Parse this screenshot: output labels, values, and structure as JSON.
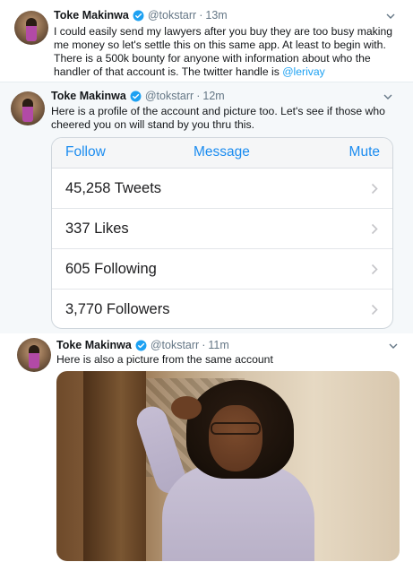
{
  "colors": {
    "link": "#1da1f2",
    "verified": "#1da1f2",
    "card_action": "#1b8cf0"
  },
  "tweets": [
    {
      "name": "Toke Makinwa",
      "handle": "@tokstarr",
      "dot": "·",
      "time": "13m",
      "text": "I could easily send my lawyers after you buy they are too busy making me money so let's settle this on this same app. At least to begin with. There is a 500k bounty for anyone with information about who the handler of that account is. The twitter handle is ",
      "mention": "@lerivay"
    },
    {
      "name": "Toke Makinwa",
      "handle": "@tokstarr",
      "dot": "·",
      "time": "12m",
      "text": "Here is a profile of the account and picture too. Let's see if those who cheered you on will stand by you thru this."
    },
    {
      "name": "Toke Makinwa",
      "handle": "@tokstarr",
      "dot": "·",
      "time": "11m",
      "text": "Here is also a picture from the same account"
    }
  ],
  "profile_card": {
    "actions": [
      "Follow",
      "Message",
      "Mute"
    ],
    "stats": [
      "45,258 Tweets",
      "337 Likes",
      "605 Following",
      "3,770 Followers"
    ]
  },
  "icons": [
    "verified-badge-icon",
    "caret-down-icon",
    "chevron-right-icon"
  ]
}
